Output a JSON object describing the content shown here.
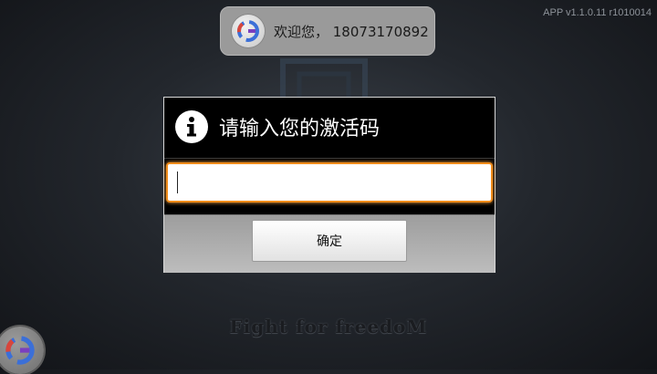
{
  "app": {
    "version_label": "APP v1.1.0.11 r1010014",
    "tagline": "Fight for freedoM"
  },
  "toast": {
    "message": "欢迎您， 18073170892",
    "icon": "g-logo-icon"
  },
  "dialog": {
    "title": "请输入您的激活码",
    "title_icon": "info-icon",
    "input": {
      "value": "",
      "placeholder": ""
    },
    "confirm_label": "确定"
  },
  "floating_button": {
    "icon": "g-logo-icon"
  },
  "colors": {
    "focus_border": "#f08c1a",
    "toast_bg": "#9a9a9a",
    "dialog_bg": "#000000"
  }
}
